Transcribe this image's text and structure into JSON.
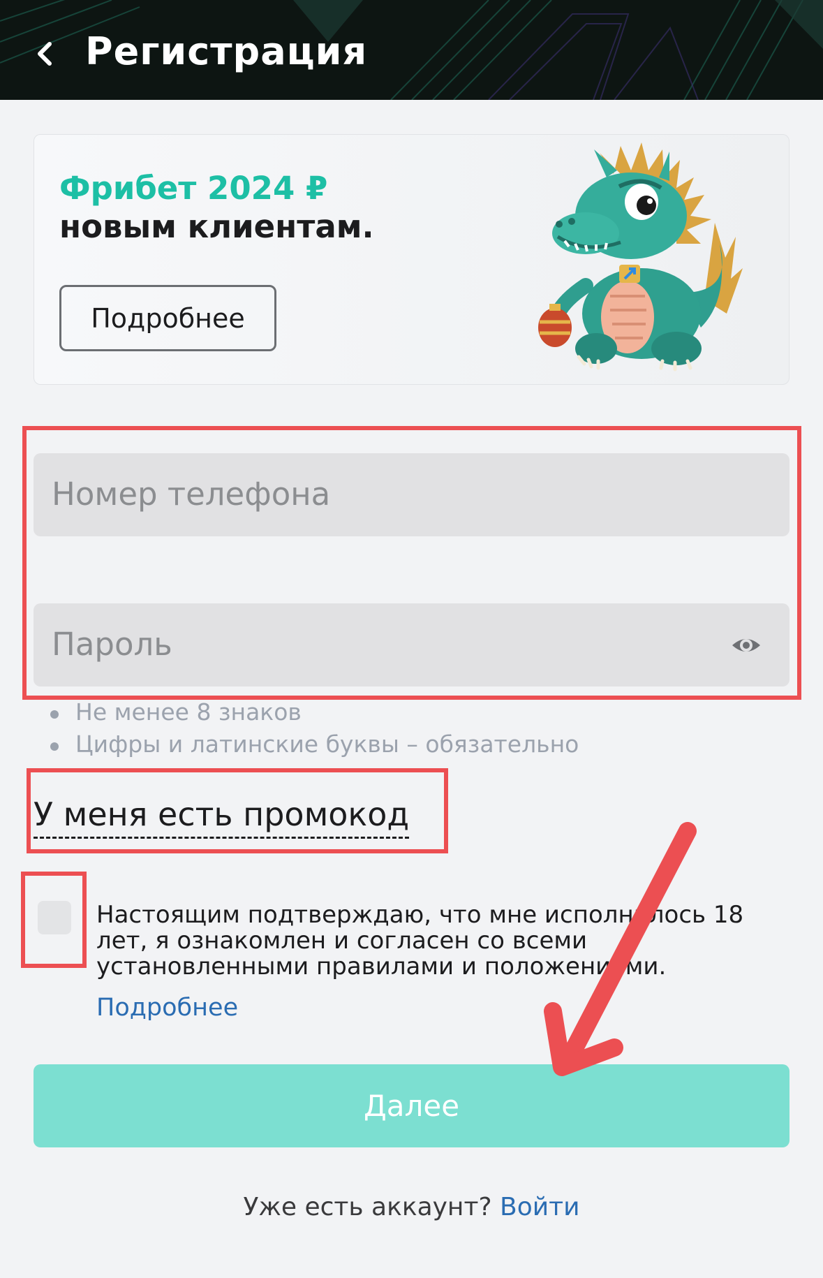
{
  "header": {
    "title": "Регистрация",
    "back_icon": "chevron-left-icon"
  },
  "promo": {
    "line1": "Фрибет 2024 ₽",
    "line2": "новым клиентам.",
    "button_label": "Подробнее",
    "image": "dragon-mascot"
  },
  "form": {
    "phone_placeholder": "Номер телефона",
    "password_placeholder": "Пароль",
    "password_toggle_icon": "eye-icon",
    "hints": [
      "Не менее 8 знаков",
      "Цифры и латинские буквы – обязательно"
    ],
    "promocode_label": "У меня есть промокод",
    "consent_text": "Настоящим подтверждаю, что мне исполнилось 18 лет, я ознакомлен и согласен со всеми установленными правилами и положениями.",
    "consent_link": "Подробнее",
    "next_label": "Далее"
  },
  "footer": {
    "question": "Уже есть аккаунт? ",
    "login_link": "Войти"
  },
  "colors": {
    "accent": "#1dbfa5",
    "button_disabled": "#7cdfd1",
    "link": "#2a6cb2",
    "annotation": "#ec4f52"
  }
}
